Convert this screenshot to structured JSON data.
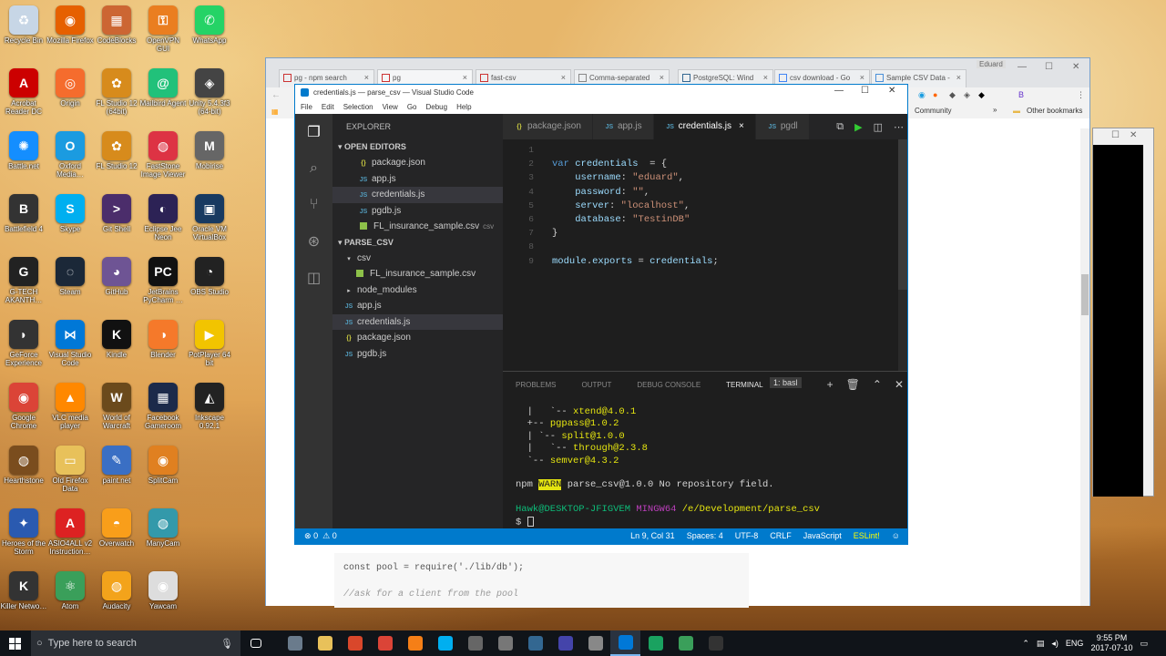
{
  "desktop_icons": [
    {
      "label": "Recycle Bin",
      "icon": "recycle-bin-icon",
      "color": "#c7d6e6",
      "glyph": "♻",
      "col": 0,
      "row": 0
    },
    {
      "label": "Mozilla Firefox",
      "icon": "firefox-icon",
      "color": "#e66000",
      "glyph": "◉",
      "col": 1,
      "row": 0
    },
    {
      "label": "CodeBlocks",
      "icon": "codeblocks-icon",
      "color": "#c63",
      "glyph": "▦",
      "col": 2,
      "row": 0
    },
    {
      "label": "OpenVPN GUI",
      "icon": "openvpn-icon",
      "color": "#ea7e20",
      "glyph": "⚿",
      "col": 3,
      "row": 0
    },
    {
      "label": "WhatsApp",
      "icon": "whatsapp-icon",
      "color": "#25d366",
      "glyph": "✆",
      "col": 4,
      "row": 0
    },
    {
      "label": "Acrobat Reader DC",
      "icon": "acrobat-icon",
      "color": "#c00",
      "glyph": "A",
      "col": 0,
      "row": 1
    },
    {
      "label": "Origin",
      "icon": "origin-icon",
      "color": "#f56c2d",
      "glyph": "◎",
      "col": 1,
      "row": 1
    },
    {
      "label": "FL Studio 12 (64bit)",
      "icon": "fl-studio-icon",
      "color": "#d78b1c",
      "glyph": "✿",
      "col": 2,
      "row": 1
    },
    {
      "label": "Mailbird Agent",
      "icon": "mailbird-icon",
      "color": "#21c17a",
      "glyph": "@",
      "col": 3,
      "row": 1
    },
    {
      "label": "Unity 5.4.3f3 (64-bit)",
      "icon": "unity-icon",
      "color": "#444",
      "glyph": "◈",
      "col": 4,
      "row": 1
    },
    {
      "label": "Battle.net",
      "icon": "battlenet-icon",
      "color": "#148eff",
      "glyph": "✺",
      "col": 0,
      "row": 2
    },
    {
      "label": "Oxford Media…",
      "icon": "oxford-icon",
      "color": "#1b9be0",
      "glyph": "O",
      "col": 1,
      "row": 2
    },
    {
      "label": "FL Studio 12",
      "icon": "fl-studio-icon",
      "color": "#d78b1c",
      "glyph": "✿",
      "col": 2,
      "row": 2
    },
    {
      "label": "FastStone Image Viewer",
      "icon": "faststone-icon",
      "color": "#d34",
      "glyph": "◍",
      "col": 3,
      "row": 2
    },
    {
      "label": "Mobirise",
      "icon": "mobirise-icon",
      "color": "#666",
      "glyph": "M",
      "col": 4,
      "row": 2
    },
    {
      "label": "Battlefield 4",
      "icon": "battlefield-icon",
      "color": "#333",
      "glyph": "B",
      "col": 0,
      "row": 3
    },
    {
      "label": "Skype",
      "icon": "skype-icon",
      "color": "#00aff0",
      "glyph": "S",
      "col": 1,
      "row": 3
    },
    {
      "label": "Git Shell",
      "icon": "git-shell-icon",
      "color": "#4b2d6b",
      "glyph": ">",
      "col": 2,
      "row": 3
    },
    {
      "label": "Eclipse Jee Neon",
      "icon": "eclipse-icon",
      "color": "#2c2255",
      "glyph": "◐",
      "col": 3,
      "row": 3
    },
    {
      "label": "Oracle VM VirtualBox",
      "icon": "virtualbox-icon",
      "color": "#183a61",
      "glyph": "▣",
      "col": 4,
      "row": 3
    },
    {
      "label": "G-TECH AKANTH…",
      "icon": "gtech-icon",
      "color": "#222",
      "glyph": "G",
      "col": 0,
      "row": 4
    },
    {
      "label": "Steam",
      "icon": "steam-icon",
      "color": "#1b2838",
      "glyph": "◌",
      "col": 1,
      "row": 4
    },
    {
      "label": "GitHub",
      "icon": "github-icon",
      "color": "#6e5494",
      "glyph": "◕",
      "col": 2,
      "row": 4
    },
    {
      "label": "JetBrains PyCharm …",
      "icon": "pycharm-icon",
      "color": "#111",
      "glyph": "PC",
      "col": 3,
      "row": 4
    },
    {
      "label": "OBS Studio",
      "icon": "obs-icon",
      "color": "#222",
      "glyph": "◔",
      "col": 4,
      "row": 4
    },
    {
      "label": "GeForce Experience",
      "icon": "geforce-icon",
      "color": "#333",
      "glyph": "◗",
      "col": 0,
      "row": 5
    },
    {
      "label": "Visual Studio Code",
      "icon": "vscode-icon",
      "color": "#0078d7",
      "glyph": "⋈",
      "col": 1,
      "row": 5
    },
    {
      "label": "Kindle",
      "icon": "kindle-icon",
      "color": "#111",
      "glyph": "K",
      "col": 2,
      "row": 5
    },
    {
      "label": "Blender",
      "icon": "blender-icon",
      "color": "#f5792a",
      "glyph": "◑",
      "col": 3,
      "row": 5
    },
    {
      "label": "PotPlayer 64 bit",
      "icon": "potplayer-icon",
      "color": "#f2c400",
      "glyph": "▶",
      "col": 4,
      "row": 5
    },
    {
      "label": "Google Chrome",
      "icon": "chrome-icon",
      "color": "#db4437",
      "glyph": "◉",
      "col": 0,
      "row": 6
    },
    {
      "label": "VLC media player",
      "icon": "vlc-icon",
      "color": "#f80",
      "glyph": "▲",
      "col": 1,
      "row": 6
    },
    {
      "label": "World of Warcraft",
      "icon": "wow-icon",
      "color": "#6b4a1c",
      "glyph": "W",
      "col": 2,
      "row": 6
    },
    {
      "label": "Facebook Gameroom",
      "icon": "gameroom-icon",
      "color": "#1c2a4a",
      "glyph": "▦",
      "col": 3,
      "row": 6
    },
    {
      "label": "Inkscape 0.92.1",
      "icon": "inkscape-icon",
      "color": "#222",
      "glyph": "◭",
      "col": 4,
      "row": 6
    },
    {
      "label": "Hearthstone",
      "icon": "hearthstone-icon",
      "color": "#7a4d1e",
      "glyph": "◍",
      "col": 0,
      "row": 7
    },
    {
      "label": "Old Firefox Data",
      "icon": "folder-icon",
      "color": "#e8c15a",
      "glyph": "▭",
      "col": 1,
      "row": 7
    },
    {
      "label": "paint.net",
      "icon": "paintnet-icon",
      "color": "#3a6fc4",
      "glyph": "✎",
      "col": 2,
      "row": 7
    },
    {
      "label": "SplitCam",
      "icon": "splitcam-icon",
      "color": "#e08020",
      "glyph": "◉",
      "col": 3,
      "row": 7
    },
    {
      "label": "Heroes of the Storm",
      "icon": "hots-icon",
      "color": "#2a5ab0",
      "glyph": "✦",
      "col": 0,
      "row": 8
    },
    {
      "label": "ASIO4ALL v2 Instruction…",
      "icon": "pdf-icon",
      "color": "#d22",
      "glyph": "A",
      "col": 1,
      "row": 8
    },
    {
      "label": "Overwatch",
      "icon": "overwatch-icon",
      "color": "#f99e1a",
      "glyph": "◓",
      "col": 2,
      "row": 8
    },
    {
      "label": "ManyCam",
      "icon": "manycam-icon",
      "color": "#39a",
      "glyph": "◍",
      "col": 3,
      "row": 8
    },
    {
      "label": "Killer Netwo…",
      "icon": "killer-icon",
      "color": "#333",
      "glyph": "K",
      "col": 0,
      "row": 9
    },
    {
      "label": "Atom",
      "icon": "atom-icon",
      "color": "#3a9f5a",
      "glyph": "⚛",
      "col": 1,
      "row": 9
    },
    {
      "label": "Audacity",
      "icon": "audacity-icon",
      "color": "#f3a31b",
      "glyph": "◍",
      "col": 2,
      "row": 9
    },
    {
      "label": "Yawcam",
      "icon": "yawcam-icon",
      "color": "#ddd",
      "glyph": "◉",
      "col": 3,
      "row": 9
    }
  ],
  "taskbar": {
    "search_placeholder": "Type here to search",
    "apps": [
      "#6a7b8c",
      "#e8c15a",
      "#d9472b",
      "#db4437",
      "#f57f17",
      "#00aff0",
      "#666",
      "#777",
      "#336791",
      "#44a",
      "#888",
      "#0078d7",
      "#1aa260",
      "#3a9f5a",
      "#333"
    ],
    "active_app_index": 11,
    "tray_lang": "ENG",
    "time": "9:55 PM",
    "date": "2017-07-10"
  },
  "chrome": {
    "profile": "Eduard",
    "tabs": [
      "pg - npm search",
      "pg",
      "fast-csv",
      "Comma-separated",
      "PostgreSQL: Wind",
      "csv download - Go",
      "Sample CSV Data -"
    ],
    "bookmarks": [
      "Community",
      "Other bookmarks"
    ],
    "snippet": {
      "line1": "const pool = require('./lib/db');",
      "comment": "//ask for a client from the pool"
    }
  },
  "vscode": {
    "title": "credentials.js — parse_csv — Visual Studio Code",
    "menu": [
      "File",
      "Edit",
      "Selection",
      "View",
      "Go",
      "Debug",
      "Help"
    ],
    "explorer_title": "EXPLORER",
    "open_editors_header": "OPEN EDITORS",
    "open_editors": [
      {
        "name": "package.json",
        "type": "json"
      },
      {
        "name": "app.js",
        "type": "js"
      },
      {
        "name": "credentials.js",
        "type": "js",
        "selected": true
      },
      {
        "name": "pgdb.js",
        "type": "js"
      },
      {
        "name": "FL_insurance_sample.csv",
        "type": "csvb",
        "extra": "csv"
      }
    ],
    "project_header": "PARSE_CSV",
    "tree": [
      {
        "name": "csv",
        "type": "folder-open",
        "indent": 1
      },
      {
        "name": "FL_insurance_sample.csv",
        "type": "csvb",
        "indent": 2
      },
      {
        "name": "node_modules",
        "type": "folder",
        "indent": 1
      },
      {
        "name": "app.js",
        "type": "js",
        "indent": 1
      },
      {
        "name": "credentials.js",
        "type": "js",
        "indent": 1,
        "selected": true
      },
      {
        "name": "package.json",
        "type": "json",
        "indent": 1
      },
      {
        "name": "pgdb.js",
        "type": "js",
        "indent": 1
      }
    ],
    "tabs": [
      {
        "name": "package.json",
        "type": "json"
      },
      {
        "name": "app.js",
        "type": "js"
      },
      {
        "name": "credentials.js",
        "type": "js",
        "active": true
      },
      {
        "name": "pgdl",
        "type": "js"
      }
    ],
    "code_lines": [
      {
        "n": "1",
        "parts": []
      },
      {
        "n": "2",
        "parts": [
          [
            "kw",
            "var "
          ],
          [
            "var",
            "credentials"
          ],
          [
            "",
            "  = {"
          ]
        ]
      },
      {
        "n": "3",
        "parts": [
          [
            "",
            "    "
          ],
          [
            "var",
            "username"
          ],
          [
            "",
            ": "
          ],
          [
            "str",
            "\"eduard\""
          ],
          [
            "",
            ","
          ]
        ]
      },
      {
        "n": "4",
        "parts": [
          [
            "",
            "    "
          ],
          [
            "var",
            "password"
          ],
          [
            "",
            ": "
          ],
          [
            "str",
            "\"\""
          ],
          [
            "",
            ","
          ]
        ]
      },
      {
        "n": "5",
        "parts": [
          [
            "",
            "    "
          ],
          [
            "var",
            "server"
          ],
          [
            "",
            ": "
          ],
          [
            "str",
            "\"localhost\""
          ],
          [
            "",
            ","
          ]
        ]
      },
      {
        "n": "6",
        "parts": [
          [
            "",
            "    "
          ],
          [
            "var",
            "database"
          ],
          [
            "",
            ": "
          ],
          [
            "str",
            "\"TestinDB\""
          ]
        ]
      },
      {
        "n": "7",
        "parts": [
          [
            "",
            "}"
          ]
        ]
      },
      {
        "n": "8",
        "parts": []
      },
      {
        "n": "9",
        "parts": [
          [
            "var",
            "module"
          ],
          [
            "",
            "."
          ],
          [
            "var",
            "exports"
          ],
          [
            "",
            " = "
          ],
          [
            "var",
            "credentials"
          ],
          [
            "",
            ";"
          ]
        ]
      }
    ],
    "panel_tabs": [
      "PROBLEMS",
      "OUTPUT",
      "DEBUG CONSOLE",
      "TERMINAL"
    ],
    "terminal_select": "1: basl",
    "terminal": [
      [
        [
          "",
          "  |   `-- "
        ],
        [
          "ty",
          "xtend@4.0.1"
        ]
      ],
      [
        [
          "",
          "  +-- "
        ],
        [
          "ty",
          "pgpass@1.0.2"
        ]
      ],
      [
        [
          "",
          "  | `-- "
        ],
        [
          "ty",
          "split@1.0.0"
        ]
      ],
      [
        [
          "",
          "  |   `-- "
        ],
        [
          "ty",
          "through@2.3.8"
        ]
      ],
      [
        [
          "",
          "  `-- "
        ],
        [
          "ty",
          "semver@4.3.2"
        ]
      ],
      [],
      [
        [
          "",
          "npm "
        ],
        [
          "warn",
          "WARN"
        ],
        [
          "",
          " parse_csv@1.0.0 No repository field."
        ]
      ],
      [],
      [
        [
          "tg",
          "Hawk@DESKTOP-JFIGVEM "
        ],
        [
          "tm",
          "MINGW64 "
        ],
        [
          "ty",
          "/e/Development/parse_csv"
        ]
      ],
      [
        [
          "",
          "$ "
        ],
        [
          "cursor",
          ""
        ]
      ]
    ],
    "status": {
      "errors": "0",
      "warnings": "0",
      "position": "Ln 9, Col 31",
      "spaces": "Spaces: 4",
      "encoding": "UTF-8",
      "eol": "CRLF",
      "language": "JavaScript",
      "linter": "ESLint!"
    }
  }
}
